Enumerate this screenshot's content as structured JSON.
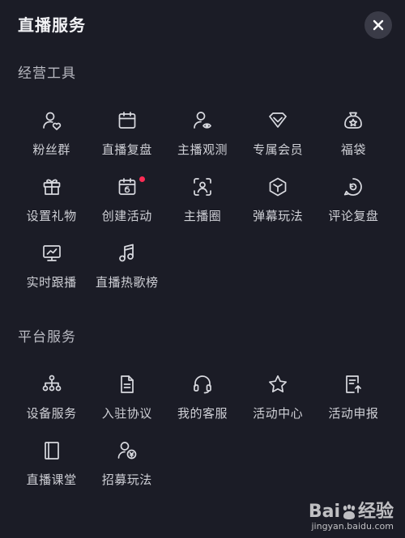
{
  "header": {
    "title": "直播服务",
    "close_icon": "close-icon"
  },
  "sections": [
    {
      "title": "经营工具",
      "items": [
        {
          "label": "粉丝群",
          "icon": "fans-group-icon"
        },
        {
          "label": "直播复盘",
          "icon": "calendar-icon"
        },
        {
          "label": "主播观测",
          "icon": "user-eye-icon"
        },
        {
          "label": "专属会员",
          "icon": "diamond-icon"
        },
        {
          "label": "福袋",
          "icon": "lucky-bag-icon"
        },
        {
          "label": "设置礼物",
          "icon": "gift-icon"
        },
        {
          "label": "创建活动",
          "icon": "calendar-6-icon",
          "badge": true
        },
        {
          "label": "主播圈",
          "icon": "face-scan-icon"
        },
        {
          "label": "弹幕玩法",
          "icon": "hexagon-icon"
        },
        {
          "label": "评论复盘",
          "icon": "comment-replay-icon"
        },
        {
          "label": "实时跟播",
          "icon": "monitor-chart-icon"
        },
        {
          "label": "直播热歌榜",
          "icon": "music-note-icon"
        }
      ]
    },
    {
      "title": "平台服务",
      "items": [
        {
          "label": "设备服务",
          "icon": "hierarchy-icon"
        },
        {
          "label": "入驻协议",
          "icon": "document-icon"
        },
        {
          "label": "我的客服",
          "icon": "headset-icon"
        },
        {
          "label": "活动中心",
          "icon": "star-icon"
        },
        {
          "label": "活动申报",
          "icon": "document-upload-icon"
        },
        {
          "label": "直播课堂",
          "icon": "book-icon"
        },
        {
          "label": "招募玩法",
          "icon": "user-coin-icon"
        }
      ]
    }
  ],
  "watermark": {
    "brand": "Bai",
    "brand_suffix": "经验",
    "url": "jingyan.baidu.com"
  },
  "colors": {
    "background": "#1b1c26",
    "badge": "#fe2c55",
    "icon": "#d9dae0"
  }
}
